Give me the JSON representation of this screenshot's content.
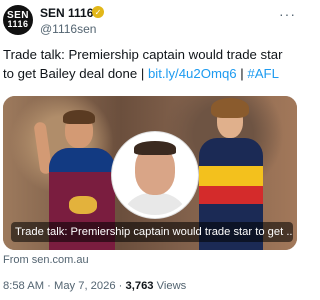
{
  "account": {
    "avatar_line1": "SEN",
    "avatar_line2": "1116",
    "name": "SEN 1116",
    "handle": "@1116sen"
  },
  "tweet": {
    "text_before_link": "Trade talk: Premiership captain would trade star to get Bailey deal done | ",
    "link": "bit.ly/4u2Omq6",
    "separator": " | ",
    "hashtag": "#AFL"
  },
  "card": {
    "caption": "Trade talk: Premiership captain would trade star to get ...",
    "source": "From sen.com.au"
  },
  "meta": {
    "time": "8:58 AM",
    "dot1": " · ",
    "date": "May 7, 2026",
    "dot2": " · ",
    "views_count": "3,763",
    "views_label": " Views"
  },
  "icons": {
    "verified": "verified-badge-icon",
    "more": "more-options-icon"
  },
  "colors": {
    "link": "#1d9bf0",
    "verified": "#e2b719"
  }
}
